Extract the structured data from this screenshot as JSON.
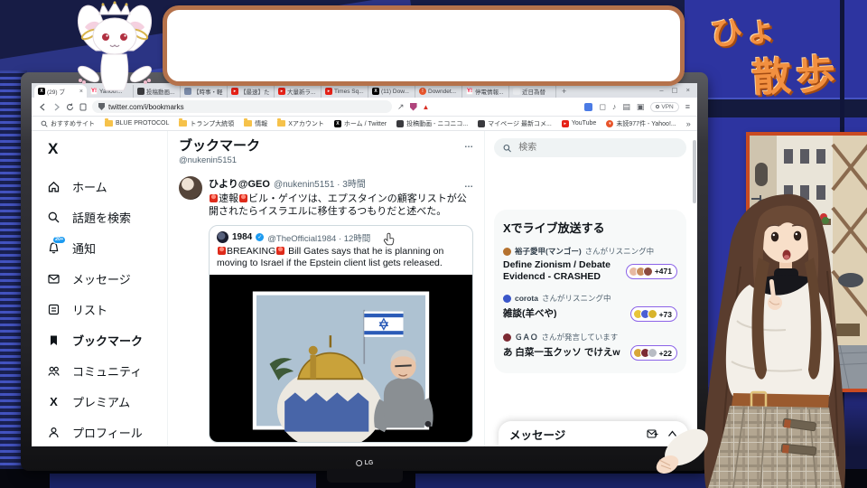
{
  "overlay": {
    "bubble_text": "",
    "title_top": "ひょ",
    "title_bottom": "散歩"
  },
  "monitor": {
    "brand": "LG"
  },
  "browser": {
    "window_controls": {
      "minimize": "–",
      "maximize": "▢",
      "close": "×"
    },
    "tabs": [
      {
        "label": "(29) ブ",
        "close": "×"
      },
      {
        "label": "Yahoo!..."
      },
      {
        "label": "投稿動画..."
      },
      {
        "label": "【時事・軽..."
      },
      {
        "label": "【最速】た..."
      },
      {
        "label": "大量新ラ..."
      },
      {
        "label": "Times Sq..."
      },
      {
        "label": "(11) Dow..."
      },
      {
        "label": "Downdet..."
      },
      {
        "label": "停電情報..."
      },
      {
        "label": "近日為替"
      }
    ],
    "new_tab": "+",
    "nav": {
      "url": "twitter.com/i/bookmarks",
      "share": "↗",
      "warn": "▲",
      "music": "♪",
      "panel": "▤",
      "reader": "▣",
      "chat": "◻",
      "vpn": "VPN",
      "menu": "≡"
    },
    "bookmarks": [
      {
        "label": "おすすめサイト"
      },
      {
        "label": "BLUE PROTOCOL"
      },
      {
        "label": "トランプ大統領"
      },
      {
        "label": "情報"
      },
      {
        "label": "Xアカウント"
      },
      {
        "label": "ホーム / Twitter"
      },
      {
        "label": "投稿動画 - ニコニコ..."
      },
      {
        "label": "マイページ 最新コメ..."
      },
      {
        "label": "YouTube"
      },
      {
        "label": "未読977件 - Yahoo!..."
      }
    ],
    "bookmarks_overflow": "»"
  },
  "twitter": {
    "sidebar": {
      "logo": "X",
      "items": [
        {
          "label": "ホーム"
        },
        {
          "label": "話題を検索"
        },
        {
          "label": "通知",
          "badge": "20+"
        },
        {
          "label": "メッセージ"
        },
        {
          "label": "リスト"
        },
        {
          "label": "ブックマーク"
        },
        {
          "label": "コミュニティ"
        },
        {
          "label": "プレミアム"
        },
        {
          "label": "プロフィール"
        }
      ]
    },
    "main": {
      "title": "ブックマーク",
      "handle": "@nukenin5151",
      "menu": "…",
      "tweet": {
        "name": "ひより@GEO",
        "meta": "@nukenin5151 · 3時間",
        "menu": "…",
        "emoji_label": "速報",
        "body": "ビル・ゲイツは、エプスタインの顧客リストが公開されたらイスラエルに移住するつもりだと述べた。",
        "quote": {
          "name": "1984",
          "verified": "✓",
          "meta": "@TheOfficial1984 · 12時間",
          "emoji_label": "BREAKING",
          "body": " Bill Gates says that he is planning on moving to Israel if the Epstein client list gets released."
        }
      }
    },
    "right": {
      "search_placeholder": "検索",
      "live": {
        "title": "Xでライブ放送する",
        "items": [
          {
            "host": "裕子愛甲(マンゴー)",
            "action": "さんがリスニング中",
            "title": "Define Zionism / Debate Evidencd - CRASHED",
            "count": "+471"
          },
          {
            "host": "corota",
            "action": "さんがリスニング中",
            "title": "雑談(羊べや)",
            "count": "+73"
          },
          {
            "host": "ＧＡＯ",
            "action": "さんが発言しています",
            "title": "あ 白菜一玉クッソ でけえw",
            "count": "+22"
          }
        ]
      },
      "messages": {
        "label": "メッセージ"
      }
    }
  }
}
